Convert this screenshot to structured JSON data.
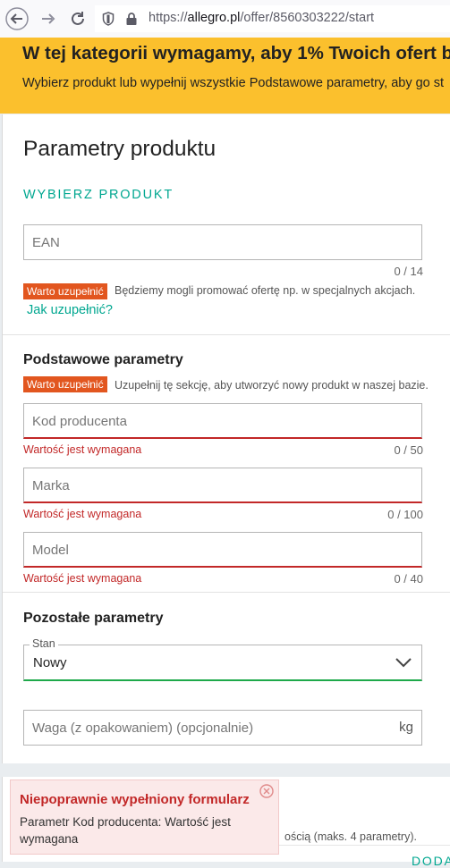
{
  "browser": {
    "url_prefix": "https://",
    "url_host": "allegro.pl",
    "url_path": "/offer/8560303222/start"
  },
  "banner": {
    "title": "W tej kategorii wymagamy, aby 1% Twoich ofert był",
    "subtitle": "Wybierz produkt lub wypełnij wszystkie Podstawowe parametry, aby go st"
  },
  "product": {
    "title": "Parametry produktu",
    "choose_product_link": "WYBIERZ PRODUKT",
    "ean": {
      "placeholder": "EAN",
      "counter": "0 / 14"
    },
    "ean_badge": "Warto uzupełnić",
    "ean_hint": "Będziemy mogli promować ofertę np. w specjalnych akcjach.",
    "how_to_link": "Jak uzupełnić?"
  },
  "basic": {
    "title": "Podstawowe parametry",
    "badge": "Warto uzupełnić",
    "hint": "Uzupełnij tę sekcję, aby utworzyć nowy produkt w naszej bazie.",
    "fields": [
      {
        "placeholder": "Kod producenta",
        "error": "Wartość jest wymagana",
        "counter": "0 / 50"
      },
      {
        "placeholder": "Marka",
        "error": "Wartość jest wymagana",
        "counter": "0 / 100"
      },
      {
        "placeholder": "Model",
        "error": "Wartość jest wymagana",
        "counter": "0 / 40"
      }
    ]
  },
  "other": {
    "title": "Pozostałe parametry",
    "condition": {
      "label": "Stan",
      "value": "Nowy"
    },
    "weight": {
      "placeholder": "Waga (z opakowaniem) (opcjonalnie)",
      "unit": "kg"
    }
  },
  "lower": {
    "hint_fragment": "ością (maks. 4 parametry).",
    "link_fragment": "DODA"
  },
  "toast": {
    "title": "Niepoprawnie wypełniony formularz",
    "message": "Parametr Kod producenta: Wartość jest wymagana"
  },
  "colors": {
    "accent": "#00a790",
    "banner": "#fbc02d",
    "error": "#c22828",
    "badge": "#e2561f",
    "valid": "#1ea94b"
  }
}
